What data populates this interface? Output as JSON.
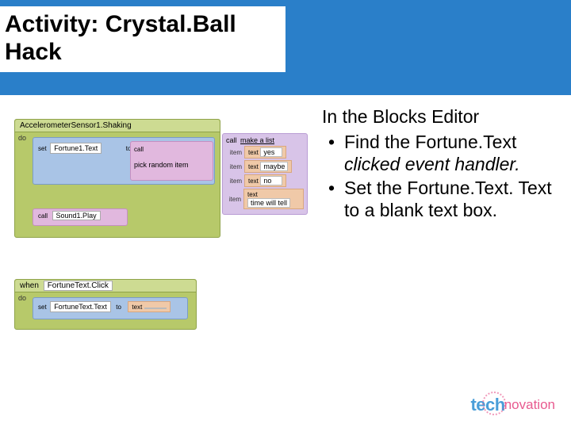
{
  "title": "Activity: Crystal.Ball Hack",
  "instructions": {
    "heading": "In the Blocks Editor",
    "bullets": [
      {
        "pre": "Find the Fortune.Text ",
        "italic": "clicked event handler.",
        "post": ""
      },
      {
        "pre": "Set the Fortune.Text. Text to a blank text box.",
        "italic": "",
        "post": ""
      }
    ]
  },
  "blocks": {
    "event1": {
      "header": "AccelerometerSensor1.Shaking",
      "do": "do",
      "set": "set",
      "setTarget": "Fortune1.Text",
      "to": "to",
      "call": "call",
      "random": "pick random item",
      "makeList": "make a list",
      "itemLabel": "item",
      "textLabel": "text",
      "items": [
        "yes",
        "maybe",
        "no",
        "time will tell"
      ],
      "sound": "Sound1.Play",
      "soundCall": "call"
    },
    "event2": {
      "when": "when",
      "header": "FortuneText.Click",
      "do": "do",
      "set": "set",
      "setTarget": "FortuneText.Text",
      "to": "to",
      "textLabel": "text",
      "textValue": ""
    }
  },
  "logo": {
    "tech": "tech",
    "novation": "novation"
  }
}
